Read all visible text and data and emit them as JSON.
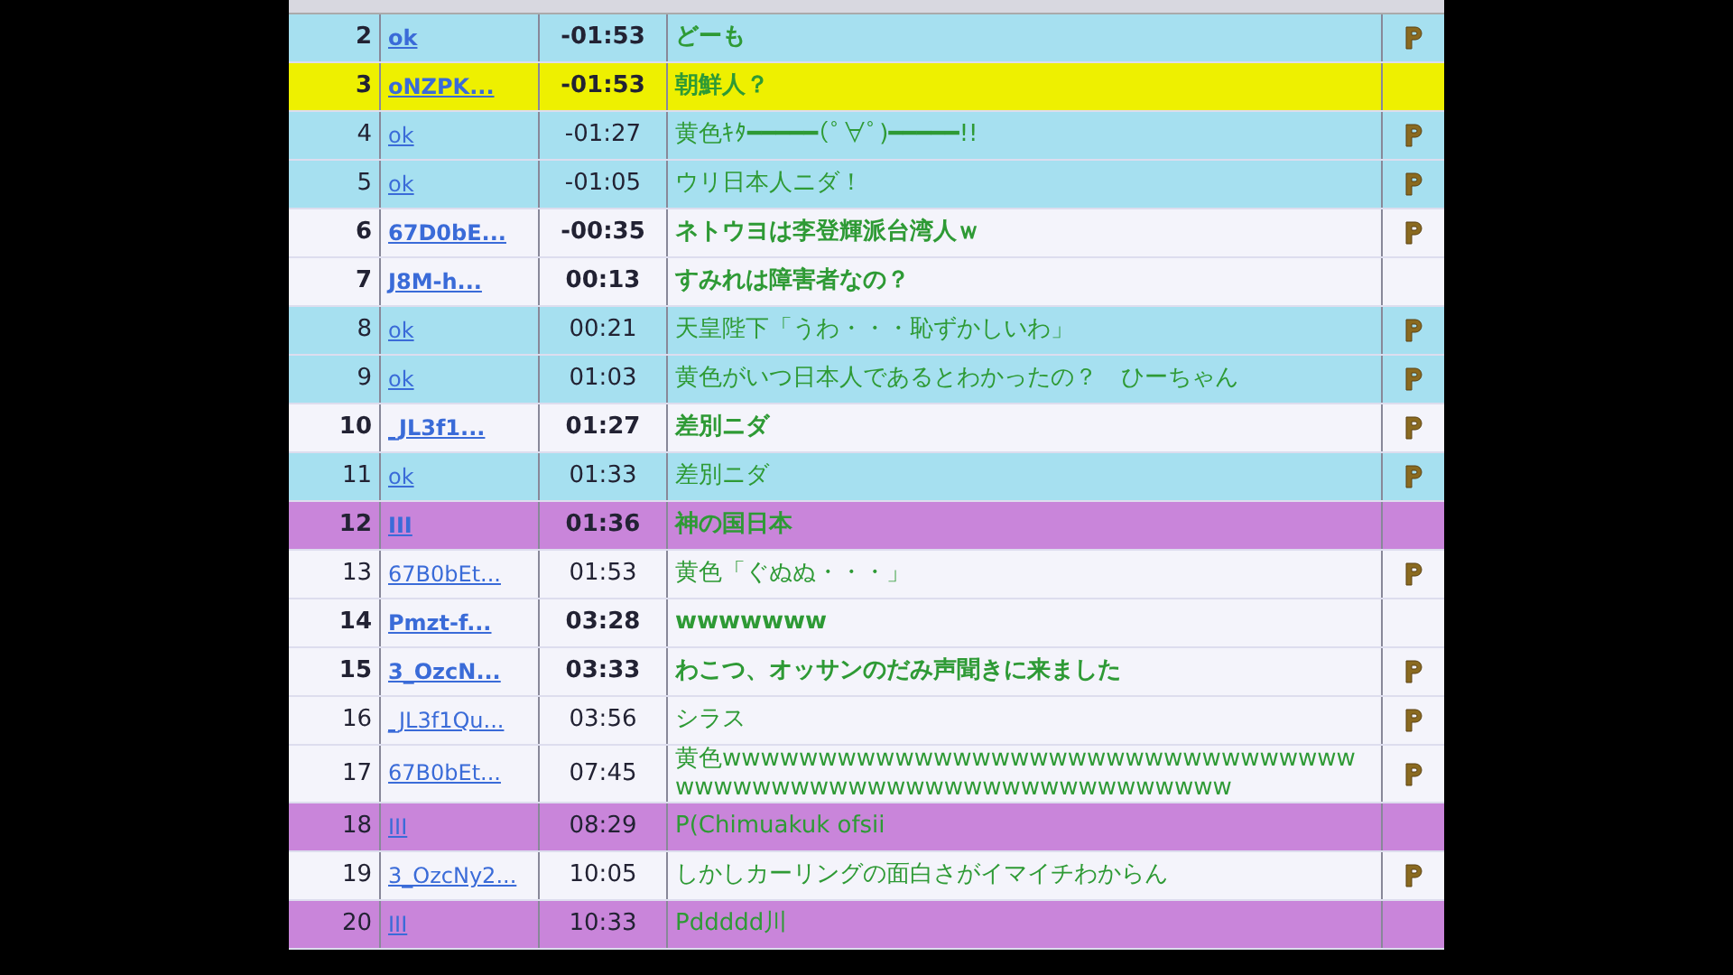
{
  "comments": [
    {
      "number": "2",
      "user": "ok",
      "time": "-01:53",
      "text": "どーも",
      "bold": true,
      "premium": true,
      "color": "#a6e0f0"
    },
    {
      "number": "3",
      "user": "oNZPK...",
      "time": "-01:53",
      "text": "朝鮮人？",
      "bold": true,
      "premium": false,
      "color": "#eef000"
    },
    {
      "number": "4",
      "user": "ok",
      "time": "-01:27",
      "text": "黄色ｷﾀ━━━━━(ﾟ∀ﾟ)━━━━━!!",
      "bold": false,
      "premium": true,
      "color": "#a6e0f0"
    },
    {
      "number": "5",
      "user": "ok",
      "time": "-01:05",
      "text": "ウリ日本人ニダ！",
      "bold": false,
      "premium": true,
      "color": "#a6e0f0"
    },
    {
      "number": "6",
      "user": "67D0bE...",
      "time": "-00:35",
      "text": "ネトウヨは李登輝派台湾人ｗ",
      "bold": true,
      "premium": true,
      "color": "#f4f4fb"
    },
    {
      "number": "7",
      "user": "J8M-h...",
      "time": "00:13",
      "text": "すみれは障害者なの？",
      "bold": true,
      "premium": false,
      "color": "#f4f4fb"
    },
    {
      "number": "8",
      "user": "ok",
      "time": "00:21",
      "text": "天皇陛下「うわ・・・恥ずかしいわ」",
      "bold": false,
      "premium": true,
      "color": "#a6e0f0"
    },
    {
      "number": "9",
      "user": "ok",
      "time": "01:03",
      "text": "黄色がいつ日本人であるとわかったの？　ひーちゃん",
      "bold": false,
      "premium": true,
      "color": "#a6e0f0"
    },
    {
      "number": "10",
      "user": "_JL3f1...",
      "time": "01:27",
      "text": "差別ニダ",
      "bold": true,
      "premium": true,
      "color": "#f4f4fb"
    },
    {
      "number": "11",
      "user": "ok",
      "time": "01:33",
      "text": "差別ニダ",
      "bold": false,
      "premium": true,
      "color": "#a6e0f0"
    },
    {
      "number": "12",
      "user": "III",
      "time": "01:36",
      "text": "神の国日本",
      "bold": true,
      "premium": false,
      "color": "#c985da"
    },
    {
      "number": "13",
      "user": "67B0bEt...",
      "time": "01:53",
      "text": "黄色「ぐぬぬ・・・」",
      "bold": false,
      "premium": true,
      "color": "#f4f4fb"
    },
    {
      "number": "14",
      "user": "Pmzt-f...",
      "time": "03:28",
      "text": "wwwwwww",
      "bold": true,
      "premium": false,
      "color": "#f4f4fb"
    },
    {
      "number": "15",
      "user": "3_OzcN...",
      "time": "03:33",
      "text": "わこつ、オッサンのだみ声聞きに来ました",
      "bold": true,
      "premium": true,
      "color": "#f4f4fb"
    },
    {
      "number": "16",
      "user": "_JL3f1Qu...",
      "time": "03:56",
      "text": "シラス",
      "bold": false,
      "premium": true,
      "color": "#f4f4fb"
    },
    {
      "number": "17",
      "user": "67B0bEt...",
      "time": "07:45",
      "text": "黄色wwwwwwwwwwwwwwwwwwwwwwwwwwwwwwwwwwwwwwwwwwwwwwwwwwwwwwwwwwwwww",
      "bold": false,
      "premium": true,
      "color": "#f4f4fb"
    },
    {
      "number": "18",
      "user": "III",
      "time": "08:29",
      "text": "P(Chimuakuk ofsii",
      "bold": false,
      "premium": false,
      "color": "#c985da"
    },
    {
      "number": "19",
      "user": "3_OzcNy2...",
      "time": "10:05",
      "text": "しかしカーリングの面白さがイマイチわからん",
      "bold": false,
      "premium": true,
      "color": "#f4f4fb"
    },
    {
      "number": "20",
      "user": "III",
      "time": "10:33",
      "text": "Pddddd川",
      "bold": false,
      "premium": false,
      "color": "#c985da"
    }
  ]
}
